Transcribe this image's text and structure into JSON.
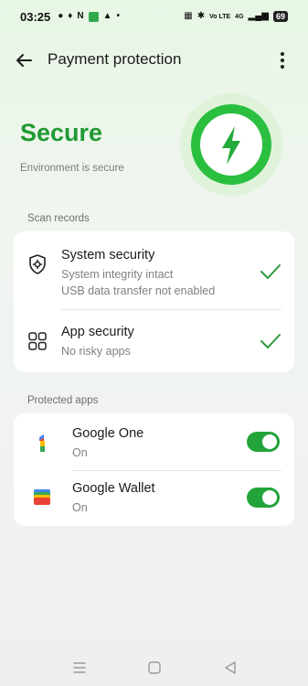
{
  "status_bar": {
    "time": "03:25",
    "left_icons": [
      "chat-icon",
      "ethereum-icon",
      "n-icon",
      "green-app-icon",
      "keyhole-icon",
      "dot-icon"
    ],
    "n_label": "N",
    "vo_lte": "Vo LTE",
    "network": "4G",
    "battery": "69"
  },
  "top_bar": {
    "title": "Payment protection"
  },
  "hero": {
    "status": "Secure",
    "subtitle": "Environment is secure",
    "accent_color": "#1f9a32"
  },
  "scan_records": {
    "label": "Scan records",
    "items": [
      {
        "title": "System security",
        "lines": [
          "System integrity intact",
          "USB data transfer not enabled"
        ],
        "icon": "shield-gear-icon",
        "status": "checked"
      },
      {
        "title": "App security",
        "lines": [
          "No risky apps"
        ],
        "icon": "app-grid-icon",
        "status": "checked"
      }
    ]
  },
  "protected_apps": {
    "label": "Protected apps",
    "items": [
      {
        "name": "Google One",
        "state": "On",
        "icon": "google-one-icon",
        "enabled": true
      },
      {
        "name": "Google Wallet",
        "state": "On",
        "icon": "google-wallet-icon",
        "enabled": true
      }
    ]
  },
  "nav_bar": {
    "buttons": [
      "recents-icon",
      "home-icon",
      "back-triangle-icon"
    ]
  }
}
